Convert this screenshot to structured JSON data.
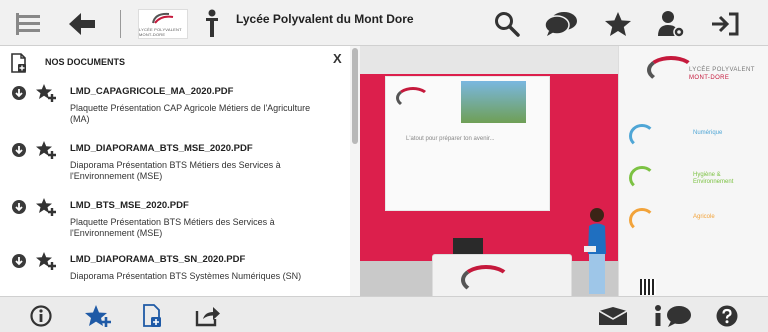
{
  "topbar": {
    "title": "Lycée Polyvalent du Mont Dore",
    "logo_text": "LYCÉE POLYVALENT MONT-DORE",
    "icons": [
      "menu-icon",
      "back-arrow-icon",
      "person-icon",
      "search-icon",
      "chat-icon",
      "star-icon",
      "user-settings-icon",
      "exit-icon"
    ]
  },
  "panel": {
    "title": "NOS DOCUMENTS",
    "close_label": "X",
    "documents": [
      {
        "filename": "LMD_CAPAGRICOLE_MA_2020.PDF",
        "description": "Plaquette Présentation CAP Agricole Métiers de l'Agriculture (MA)"
      },
      {
        "filename": "LMD_DIAPORAMA_BTS_MSE_2020.PDF",
        "description": "Diaporama Présentation BTS Métiers des Services à l'Environnement (MSE)"
      },
      {
        "filename": "LMD_BTS_MSE_2020.PDF",
        "description": "Plaquette Présentation BTS Métiers des Services à l'Environnement (MSE)"
      },
      {
        "filename": "LMD_DIAPORAMA_BTS_SN_2020.PDF",
        "description": "Diaporama Présentation BTS Systèmes Numériques (SN)"
      }
    ]
  },
  "scene": {
    "poster_caption": "L'atout pour préparer ton avenir...",
    "brand_line1": "LYCÉE POLYVALENT",
    "brand_line2": "MONT-DORE",
    "sectors": [
      {
        "label": "Numérique",
        "color": "#4fa6d6"
      },
      {
        "label": "Hygiène & Environnement",
        "color": "#7cc243"
      },
      {
        "label": "Agricole",
        "color": "#f2a33a"
      }
    ]
  },
  "colors": {
    "accent_red": "#dc1f4c",
    "icon_dark": "#333333"
  },
  "bottombar": {
    "icons": [
      "info-icon",
      "favorite-star-icon",
      "add-document-icon",
      "share-icon",
      "mail-icon",
      "chat-info-icon",
      "help-icon"
    ]
  }
}
